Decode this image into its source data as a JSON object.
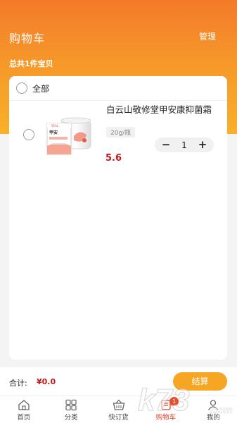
{
  "header": {
    "title": "购物车",
    "manage_label": "管理",
    "total_text": "总共1件宝贝"
  },
  "cart": {
    "select_all_label": "全部",
    "items": [
      {
        "name": "白云山敬修堂甲安康抑菌霜",
        "spec": "20g/瓶",
        "price": "5.6",
        "quantity": "1"
      }
    ]
  },
  "checkout": {
    "sum_label": "合计:",
    "sum_value": "¥0.0",
    "button_label": "结算"
  },
  "tabs": [
    {
      "label": "首页",
      "icon": "home-icon"
    },
    {
      "label": "分类",
      "icon": "grid-icon"
    },
    {
      "label": "快订货",
      "icon": "basket-icon"
    },
    {
      "label": "购物车",
      "icon": "cart-icon",
      "badge": "1",
      "active": true
    },
    {
      "label": "我的",
      "icon": "profile-icon"
    }
  ],
  "colors": {
    "header_start": "#f47a2a",
    "header_end": "#f8b02a",
    "price": "#c51919",
    "checkout_button": "#f6a623",
    "active_tab": "#e0402a"
  },
  "watermark": "k73"
}
